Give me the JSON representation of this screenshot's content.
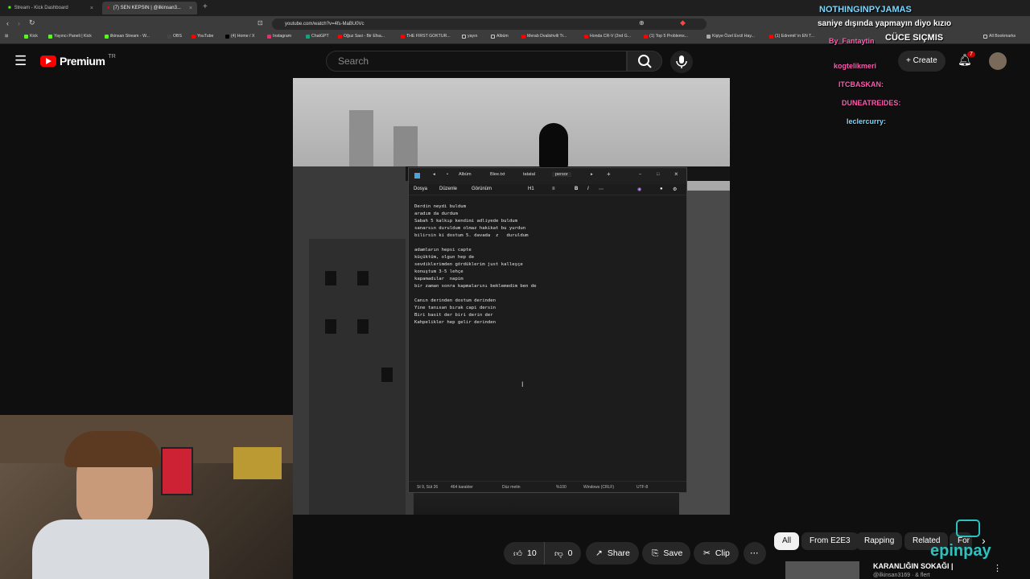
{
  "browser": {
    "tabs": [
      {
        "label": "Stream - Kick Dashboard"
      },
      {
        "label": "(7) SEN KEPSIN | @ilkinsan3..."
      }
    ],
    "url": "youtube.com/watch?v=4fs-MaBU0Vc",
    "bookmarks": [
      "Kick",
      "Yayıncı Paneli | Kick",
      "ilkinsan Stream - W...",
      "OBS",
      "YouTube",
      "(4) Home / X",
      "Instagram",
      "ChatGPT",
      "Oğuz Sasi - Bir Efsa...",
      "THE FIRST GOKTUR...",
      "yayın",
      "Albüm",
      "Merab Dvalishvili Tr...",
      "Honda CR-V (2nd G...",
      "(1) Top 5 Problems...",
      "Kişiye Özel Evcil Hay...",
      "(1) Edremit' in EN T...",
      "All Bookmarks"
    ]
  },
  "youtube": {
    "logo": "Premium",
    "region": "TR",
    "search_placeholder": "Search",
    "create_label": "Create",
    "notifications_count": "7"
  },
  "notepad": {
    "tabs": [
      "Albüm",
      "Blee.txt",
      "tatatal",
      "persor"
    ],
    "menu": [
      "Dosya",
      "Düzenle",
      "Görünüm"
    ],
    "heading_level": "H1",
    "text": "Derdin neydi buldum\naradım da durdum\nSabah 5 kalkıp kendimi adliyede buldum\nsanarsın duruldum olmaz hakikat bu yurdun\nbilirsin ki dostum 5. davada  z   duruldum\n\nadamların hepsi capte\nküçüktüm, olgun hep de\nsevdiklerimden gördüklerim just kalleşçe\nkonuştum 3-5 lehçe\nkapamadılar  napim\nbir zaman sonra kapmalarını beklemedim ben de\n\nCanın derinden dostum derinden\nYine tanısan bırak capi dersin\nBiri basit der biri derin der\nKahpelikler hep gelir derinden",
    "status": {
      "position": "St 9, Süt 26",
      "chars": "464 karakter",
      "format": "Düz metin",
      "zoom": "%100",
      "eol": "Windows (CRLF)",
      "encoding": "UTF-8"
    }
  },
  "chat": [
    {
      "user": "NOTHINGINPYJAMAS",
      "msg": ""
    },
    {
      "user": "",
      "msg": "saniye dışında yapmayın diyo kızıo"
    },
    {
      "user": "By_Fantaytin",
      "msg": "CÜCE SIÇMIS"
    },
    {
      "user": "kogtelikmeri",
      "msg": ""
    },
    {
      "user": "ITCBASKAN:",
      "msg": ""
    },
    {
      "user": "DUNEATREIDES:",
      "msg": ""
    },
    {
      "user": "leclercurry:",
      "msg": ""
    }
  ],
  "actions": {
    "like_count": "10",
    "dislike_count": "0",
    "share": "Share",
    "save": "Save",
    "clip": "Clip"
  },
  "chips": [
    "All",
    "From E2E3",
    "Rapping",
    "Related",
    "For"
  ],
  "related": {
    "title": "KARANLIĞIN SOKAĞI |",
    "channel": "@ilkinsan3169 · & flert"
  },
  "sponsor": "epinpay"
}
